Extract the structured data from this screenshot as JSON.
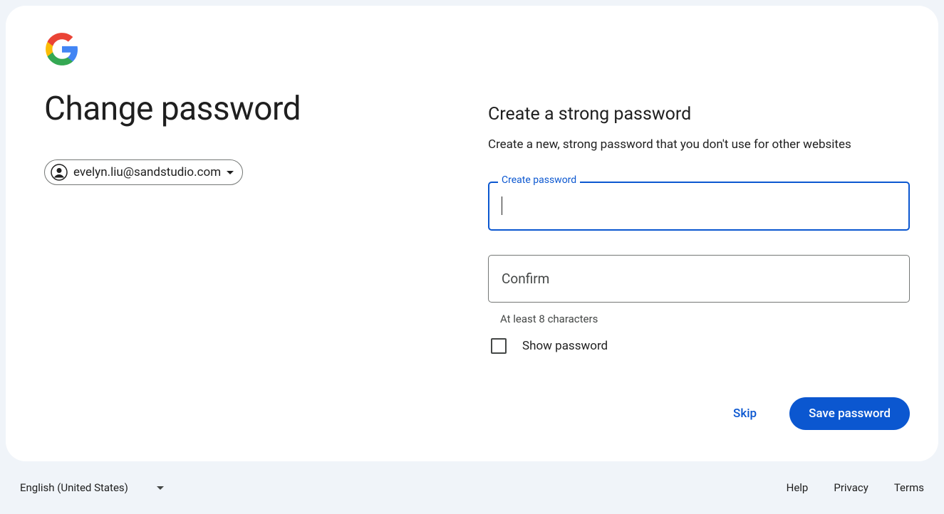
{
  "logo": {
    "name": "google-logo"
  },
  "left": {
    "title": "Change password",
    "account_email": "evelyn.liu@sandstudio.com"
  },
  "right": {
    "section_title": "Create a strong password",
    "section_desc": "Create a new, strong password that you don't use for other websites",
    "create_label": "Create password",
    "create_value": "",
    "confirm_placeholder": "Confirm",
    "confirm_value": "",
    "hint": "At least 8 characters",
    "show_password_label": "Show password",
    "show_password_checked": false
  },
  "actions": {
    "skip_label": "Skip",
    "save_label": "Save password"
  },
  "footer": {
    "language": "English (United States)",
    "links": {
      "help": "Help",
      "privacy": "Privacy",
      "terms": "Terms"
    }
  }
}
